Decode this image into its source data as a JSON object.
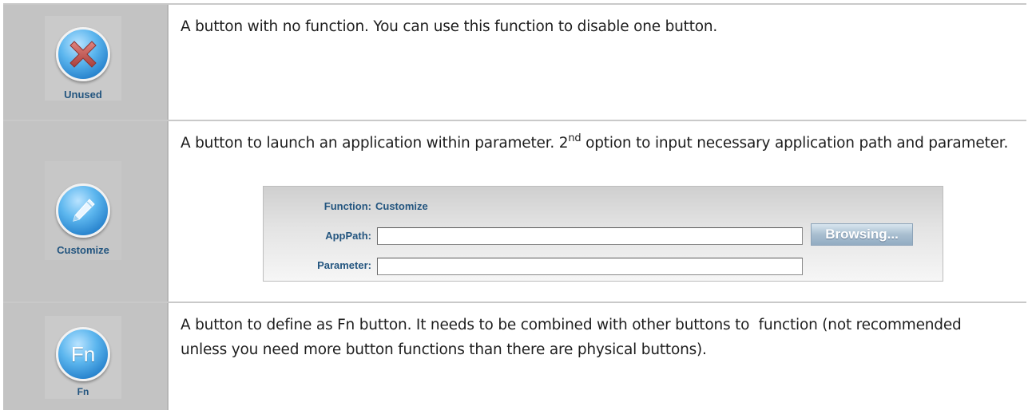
{
  "rows": [
    {
      "icon": "close-x-icon",
      "label": "Unused",
      "description": "A button with no function. You can use this function to disable one button."
    },
    {
      "icon": "pencil-icon",
      "label": "Customize",
      "description_before_sup": "A button to launch an application within parameter. 2",
      "description_sup": "nd",
      "description_after_sup": " option to input necessary application path and parameter.",
      "panel": {
        "function_label": "Function:",
        "function_value": "Customize",
        "apppath_label": "AppPath:",
        "apppath_value": "",
        "parameter_label": "Parameter:",
        "parameter_value": "",
        "browse_label": "Browsing..."
      }
    },
    {
      "icon": "fn-icon",
      "icon_text": "Fn",
      "label": "Fn",
      "description": "A button to define as Fn button. It needs to be combined with other buttons to  function (not recommended unless you need more button functions than there are physical buttons)."
    }
  ],
  "colors": {
    "icon_cell_bg": "#c3c3c3",
    "label_blue": "#23557f",
    "orb_blue": "#3a95da",
    "cross_red": "#c0504d",
    "border": "#c9c9c9"
  }
}
